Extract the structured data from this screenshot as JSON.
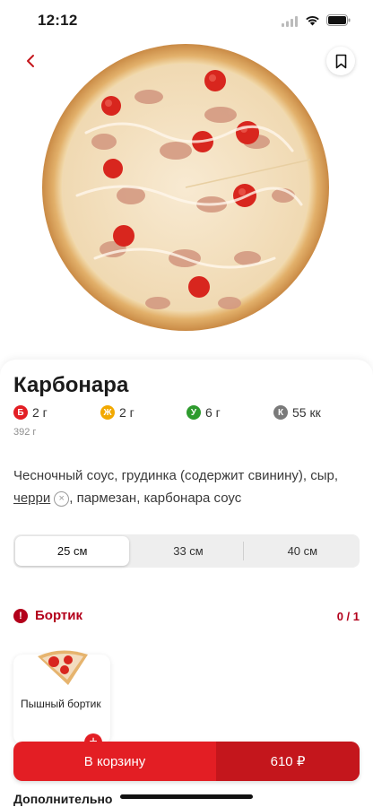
{
  "status": {
    "time": "12:12"
  },
  "product": {
    "title": "Карбонара",
    "weight": "392 г",
    "description_part1": "Чесночный соус, грудинка (содержит свинину), сыр,",
    "removable_ingredient": "черри",
    "remove_icon": "×",
    "description_part2": ", пармезан, карбонара соус"
  },
  "nutrition": [
    {
      "badge": "Б",
      "value": "2 г",
      "color": "#e31e24"
    },
    {
      "badge": "Ж",
      "value": "2 г",
      "color": "#f2a900"
    },
    {
      "badge": "У",
      "value": "6 г",
      "color": "#2e9b2e"
    },
    {
      "badge": "К",
      "value": "55 кк",
      "color": "#7a7a7a"
    }
  ],
  "sizes": {
    "options": [
      "25 см",
      "33 см",
      "40 см"
    ],
    "selected": "25 см"
  },
  "crust": {
    "icon": "!",
    "title": "Бортик",
    "count": "0 / 1",
    "items": [
      {
        "name": "Пышный бортик",
        "add_icon": "+"
      }
    ]
  },
  "cart": {
    "label": "В корзину",
    "price": "610 ₽"
  },
  "additional_title": "Дополнительно",
  "colors": {
    "accent": "#e31e24",
    "section": "#b3001b"
  }
}
